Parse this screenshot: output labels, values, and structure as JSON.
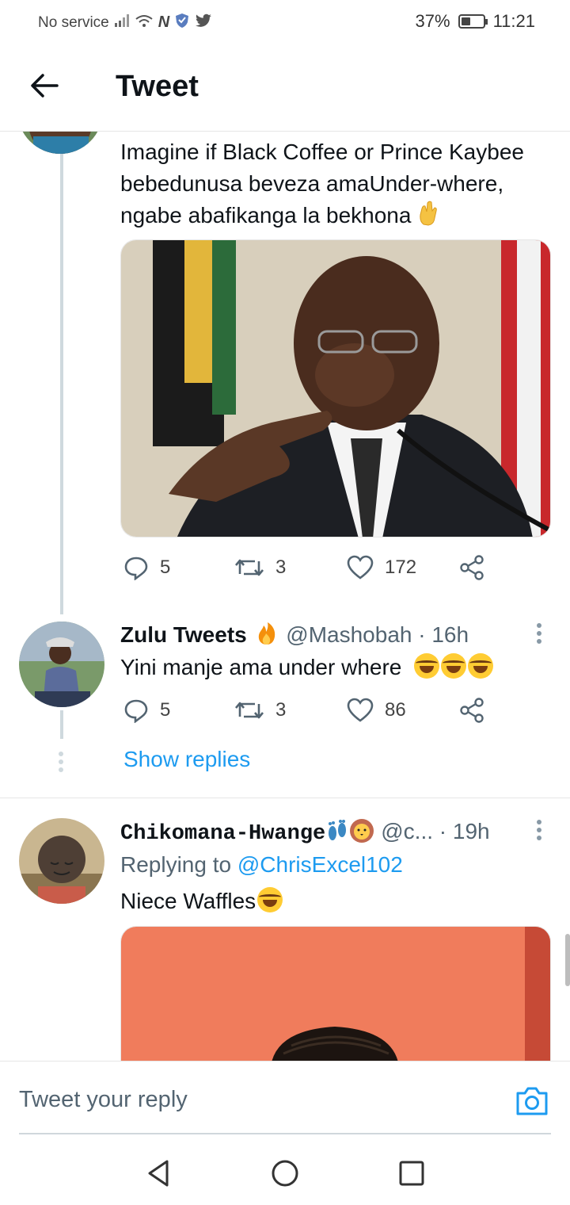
{
  "status_bar": {
    "carrier": "No service",
    "battery": "37%",
    "battery_level": 0.37,
    "time": "11:21"
  },
  "header": {
    "title": "Tweet"
  },
  "main_tweet": {
    "text": "Imagine if Black Coffee or Prince Kaybee bebedunusa beveza amaUnder-where, ngabe abafikanga la bekhona",
    "emoji": "crossed-fingers-icon",
    "actions": {
      "replies": "5",
      "retweets": "3",
      "likes": "172"
    }
  },
  "reply_1": {
    "name": "Zulu Tweets",
    "handle": "@Mashobah",
    "time": "· 16h",
    "text": "Yini manje ama under where",
    "actions": {
      "replies": "5",
      "retweets": "3",
      "likes": "86"
    },
    "show_replies": "Show replies"
  },
  "reply_2": {
    "name": "Chikomana-Hwange",
    "handle": "@c...",
    "time": "· 19h",
    "replying_prefix": "Replying to",
    "replying_to": "@ChrisExcel102",
    "text": "Niece Waffles"
  },
  "composer": {
    "placeholder": "Tweet your reply"
  },
  "colors": {
    "accent": "#1d9bf0",
    "text": "#0f1419",
    "muted": "#536471"
  }
}
